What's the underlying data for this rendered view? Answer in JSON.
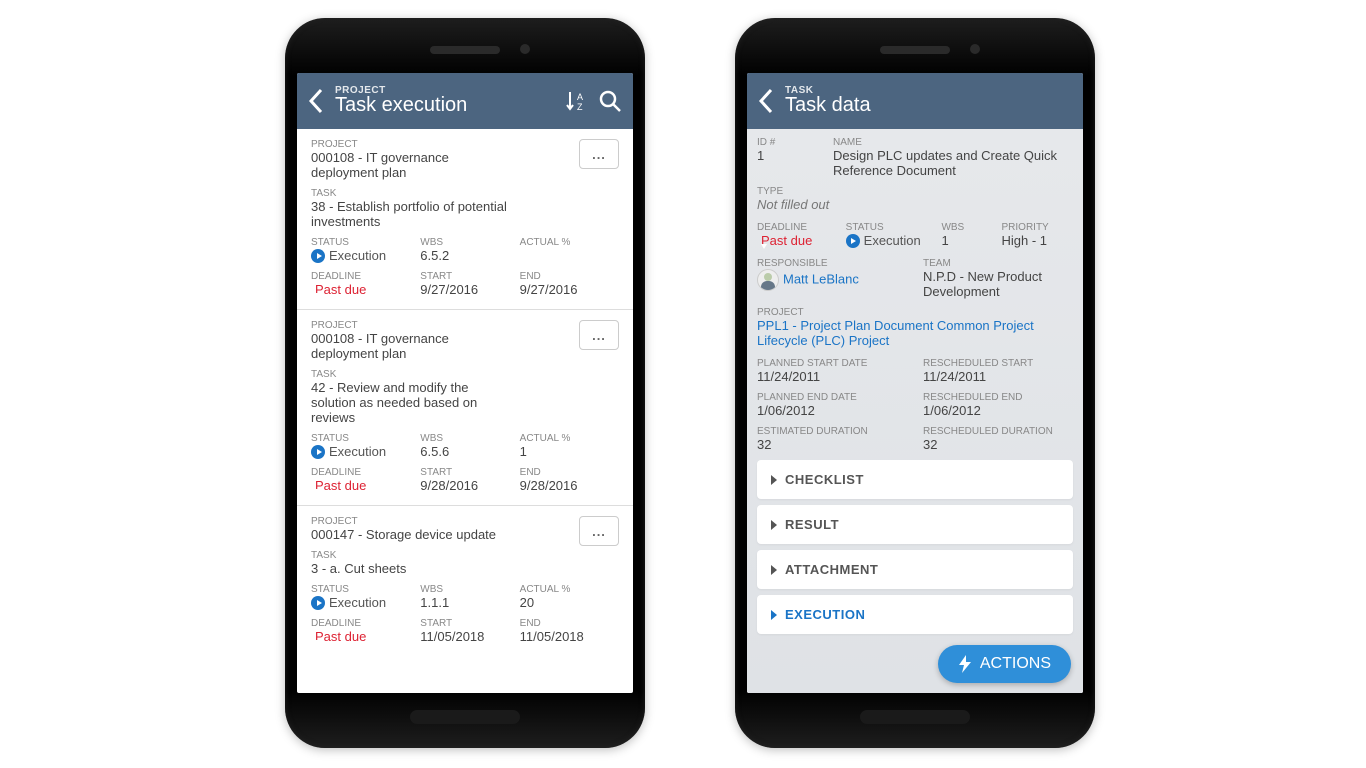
{
  "left": {
    "header": {
      "overline": "PROJECT",
      "title": "Task execution"
    },
    "icons": {
      "sort": "sort-az-icon",
      "search": "search-icon"
    },
    "labels": {
      "project": "PROJECT",
      "task": "TASK",
      "status": "STATUS",
      "wbs": "WBS",
      "actual": "ACTUAL %",
      "deadline": "DEADLINE",
      "start": "START",
      "end": "END",
      "more": "..."
    },
    "status_value": "Execution",
    "deadline_value": "Past due",
    "items": [
      {
        "project": "000108 - IT governance deployment plan",
        "task": "38 - Establish portfolio of potential investments",
        "wbs": "6.5.2",
        "actual": "",
        "start": "9/27/2016",
        "end": "9/27/2016"
      },
      {
        "project": "000108 - IT governance deployment plan",
        "task": "42 - Review and modify the solution as needed based on reviews",
        "wbs": "6.5.6",
        "actual": "1",
        "start": "9/28/2016",
        "end": "9/28/2016"
      },
      {
        "project": "000147 - Storage device update",
        "task": "3 - a. Cut sheets",
        "wbs": "1.1.1",
        "actual": "20",
        "start": "11/05/2018",
        "end": "11/05/2018"
      }
    ]
  },
  "right": {
    "header": {
      "overline": "TASK",
      "title": "Task data"
    },
    "labels": {
      "id": "ID #",
      "name": "NAME",
      "type": "TYPE",
      "deadline": "DEADLINE",
      "status": "STATUS",
      "wbs": "WBS",
      "priority": "PRIORITY",
      "responsible": "RESPONSIBLE",
      "team": "TEAM",
      "project": "PROJECT",
      "pstart": "PLANNED START DATE",
      "rstart": "RESCHEDULED START",
      "pend": "PLANNED END DATE",
      "rend": "RESCHEDULED END",
      "edur": "ESTIMATED DURATION",
      "rdur": "RESCHEDULED DURATION"
    },
    "values": {
      "id": "1",
      "name": "Design PLC updates and Create Quick Reference Document",
      "type": "Not filled out",
      "deadline": "Past due",
      "status": "Execution",
      "wbs": "1",
      "priority": "High - 1",
      "responsible": "Matt LeBlanc",
      "team": "N.P.D - New Product Development",
      "project": "PPL1 - Project Plan Document Common Project Lifecycle (PLC) Project",
      "pstart": "11/24/2011",
      "rstart": "11/24/2011",
      "pend": "1/06/2012",
      "rend": "1/06/2012",
      "edur": "32",
      "rdur": "32"
    },
    "accordion": {
      "checklist": "CHECKLIST",
      "result": "RESULT",
      "attachment": "ATTACHMENT",
      "execution": "EXECUTION"
    },
    "actions": "ACTIONS"
  }
}
